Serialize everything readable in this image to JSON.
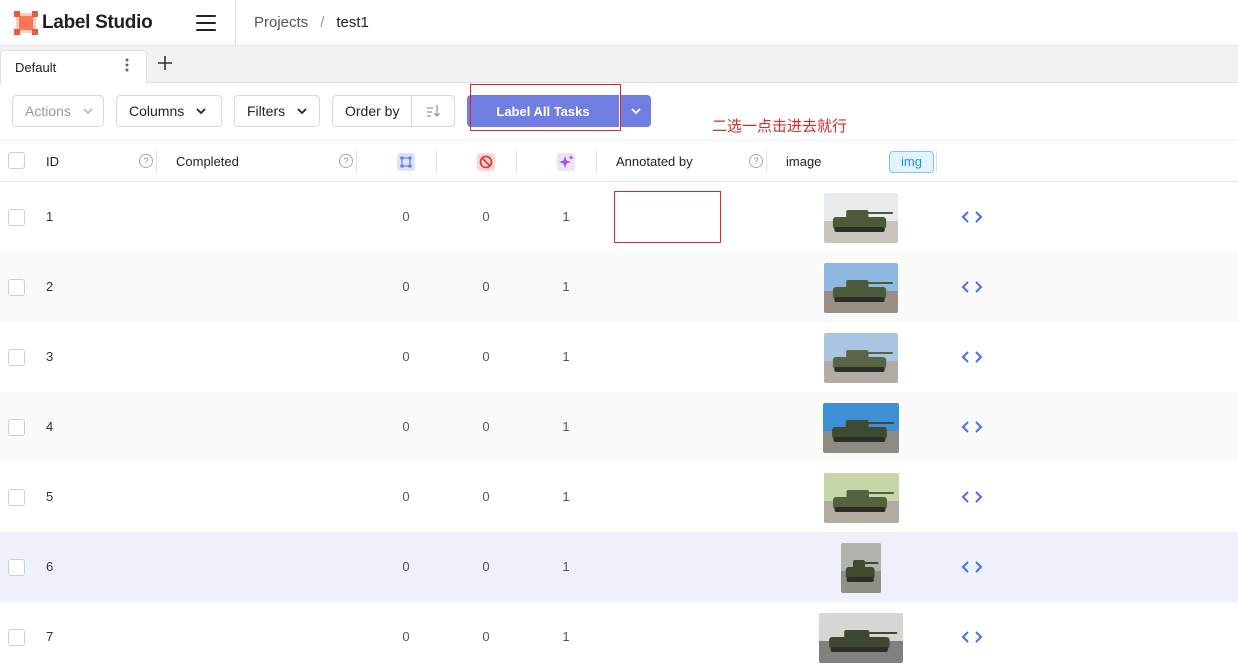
{
  "app": {
    "name": "Label Studio"
  },
  "breadcrumb": {
    "projects": "Projects",
    "separator": "/",
    "current": "test1"
  },
  "tabs": [
    {
      "label": "Default"
    }
  ],
  "toolbar": {
    "actions": "Actions",
    "columns": "Columns",
    "filters": "Filters",
    "order_by": "Order by",
    "label_all": "Label All Tasks"
  },
  "annotation_text": "二选一点击进去就行",
  "columns": {
    "id": "ID",
    "completed": "Completed",
    "annotated_by": "Annotated by",
    "image": "image",
    "image_type": "img"
  },
  "colors": {
    "accent": "#6f7ee0",
    "annotation": "#d42a2a",
    "chip": "#1890ff"
  },
  "rows": [
    {
      "id": "1",
      "total_annotations": "0",
      "cancelled": "0",
      "predictions": "1",
      "thumb": "tank-parade-1"
    },
    {
      "id": "2",
      "total_annotations": "0",
      "cancelled": "0",
      "predictions": "1",
      "thumb": "tank-parade-2"
    },
    {
      "id": "3",
      "total_annotations": "0",
      "cancelled": "0",
      "predictions": "1",
      "thumb": "tank-parade-3"
    },
    {
      "id": "4",
      "total_annotations": "0",
      "cancelled": "0",
      "predictions": "1",
      "thumb": "tank-parade-4"
    },
    {
      "id": "5",
      "total_annotations": "0",
      "cancelled": "0",
      "predictions": "1",
      "thumb": "tank-parade-5"
    },
    {
      "id": "6",
      "total_annotations": "0",
      "cancelled": "0",
      "predictions": "1",
      "thumb": "tank-parade-6"
    },
    {
      "id": "7",
      "total_annotations": "0",
      "cancelled": "0",
      "predictions": "1",
      "thumb": "tank-parade-7"
    }
  ]
}
